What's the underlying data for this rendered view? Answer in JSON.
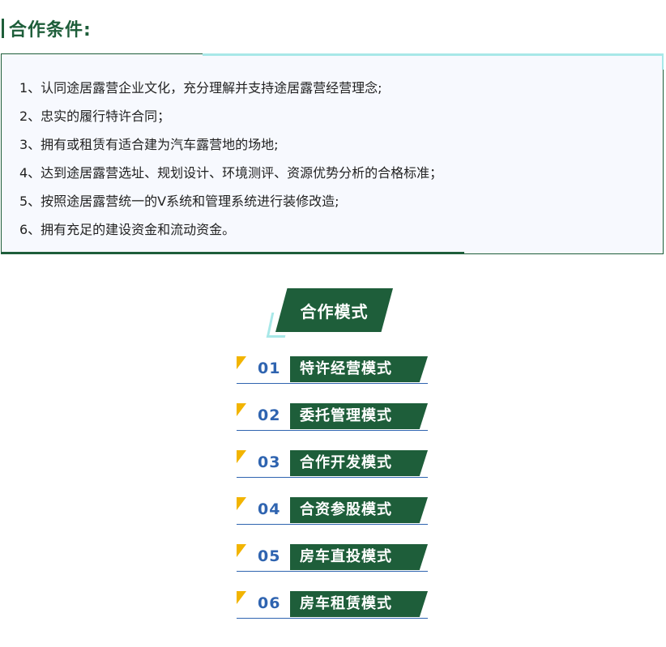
{
  "section": {
    "title": "合作条件:"
  },
  "conditions": [
    "1、认同途居露营企业文化，充分理解并支持途居露营经营理念;",
    "2、忠实的履行特许合同；",
    "3、拥有或租赁有适合建为汽车露营地的场地;",
    "4、达到途居露营选址、规划设计、环境测评、资源优势分析的合格标准；",
    "5、按照途居露营统一的V系统和管理系统进行装修改造;",
    "6、拥有充足的建设资金和流动资金。"
  ],
  "modes_title": "合作模式",
  "modes": [
    {
      "num": "01",
      "label": "特许经营模式"
    },
    {
      "num": "02",
      "label": "委托管理模式"
    },
    {
      "num": "03",
      "label": "合作开发模式"
    },
    {
      "num": "04",
      "label": "合资参股模式"
    },
    {
      "num": "05",
      "label": "房车直投模式"
    },
    {
      "num": "06",
      "label": "房车租赁模式"
    }
  ],
  "colors": {
    "primary": "#1e5e3a",
    "number": "#2f64b0",
    "triangle": "#f2b400",
    "accent": "#a8e8e8",
    "panel": "#f7f9fe"
  }
}
